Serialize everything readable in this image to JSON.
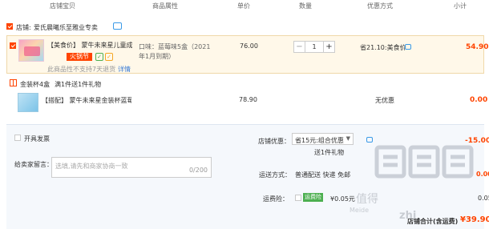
{
  "columns": {
    "shop_item": "店铺宝贝",
    "attributes": "商品属性",
    "unit_price": "单价",
    "quantity": "数量",
    "discount": "优惠方式",
    "subtotal": "小计"
  },
  "shop": {
    "label": "店铺:",
    "name": "爱氏晨曦乐至雅业专卖"
  },
  "item": {
    "title": "【美食价】 蒙牛未来星儿童成长...",
    "promo_badge": "火锅节",
    "note": "此商品性不支持7天退货",
    "note_link": "详情",
    "attributes": "口味：蓝莓味5盒（2021年1月到期）",
    "unit_price": "76.00",
    "quantity": "1",
    "discount_text": "省21.10:美食价",
    "subtotal": "54.90"
  },
  "bundle": {
    "label": "金装杯4盒",
    "promo": "满1件送1件礼物",
    "title": "【搭配】 蒙牛未来星金装杯蓝莓...",
    "unit_price": "78.90",
    "promo_text": "无优惠",
    "subtotal": "0.00"
  },
  "panel": {
    "invoice_label": "开具发票",
    "message_label": "给卖家留言：",
    "message_placeholder": "选填,请先和商家协商一致",
    "message_count": "0/200",
    "shop_discount_label": "店铺优惠：",
    "shop_discount_value": "省15元:组合优惠",
    "shop_discount_gift": "送1件礼物",
    "shop_discount_amount": "-15.00",
    "shipping_label": "运送方式：",
    "shipping_value": "普通配送 快递 免邮",
    "shipping_amount": "0.00",
    "insurance_label": "运费险：",
    "insurance_badge": "运费险",
    "insurance_price": "¥0.05元",
    "insurance_amount": "0.05",
    "total_label": "店铺合计(含运费)",
    "total_amount": "¥39.90"
  },
  "watermark": {
    "text_a": "值得",
    "text_b": "zhi",
    "small": "Meide"
  },
  "colors": {
    "accent": "#ff4400",
    "link": "#3a7bd5",
    "panel_bg": "#f5f8fc",
    "item_bg": "#fff8e9"
  }
}
